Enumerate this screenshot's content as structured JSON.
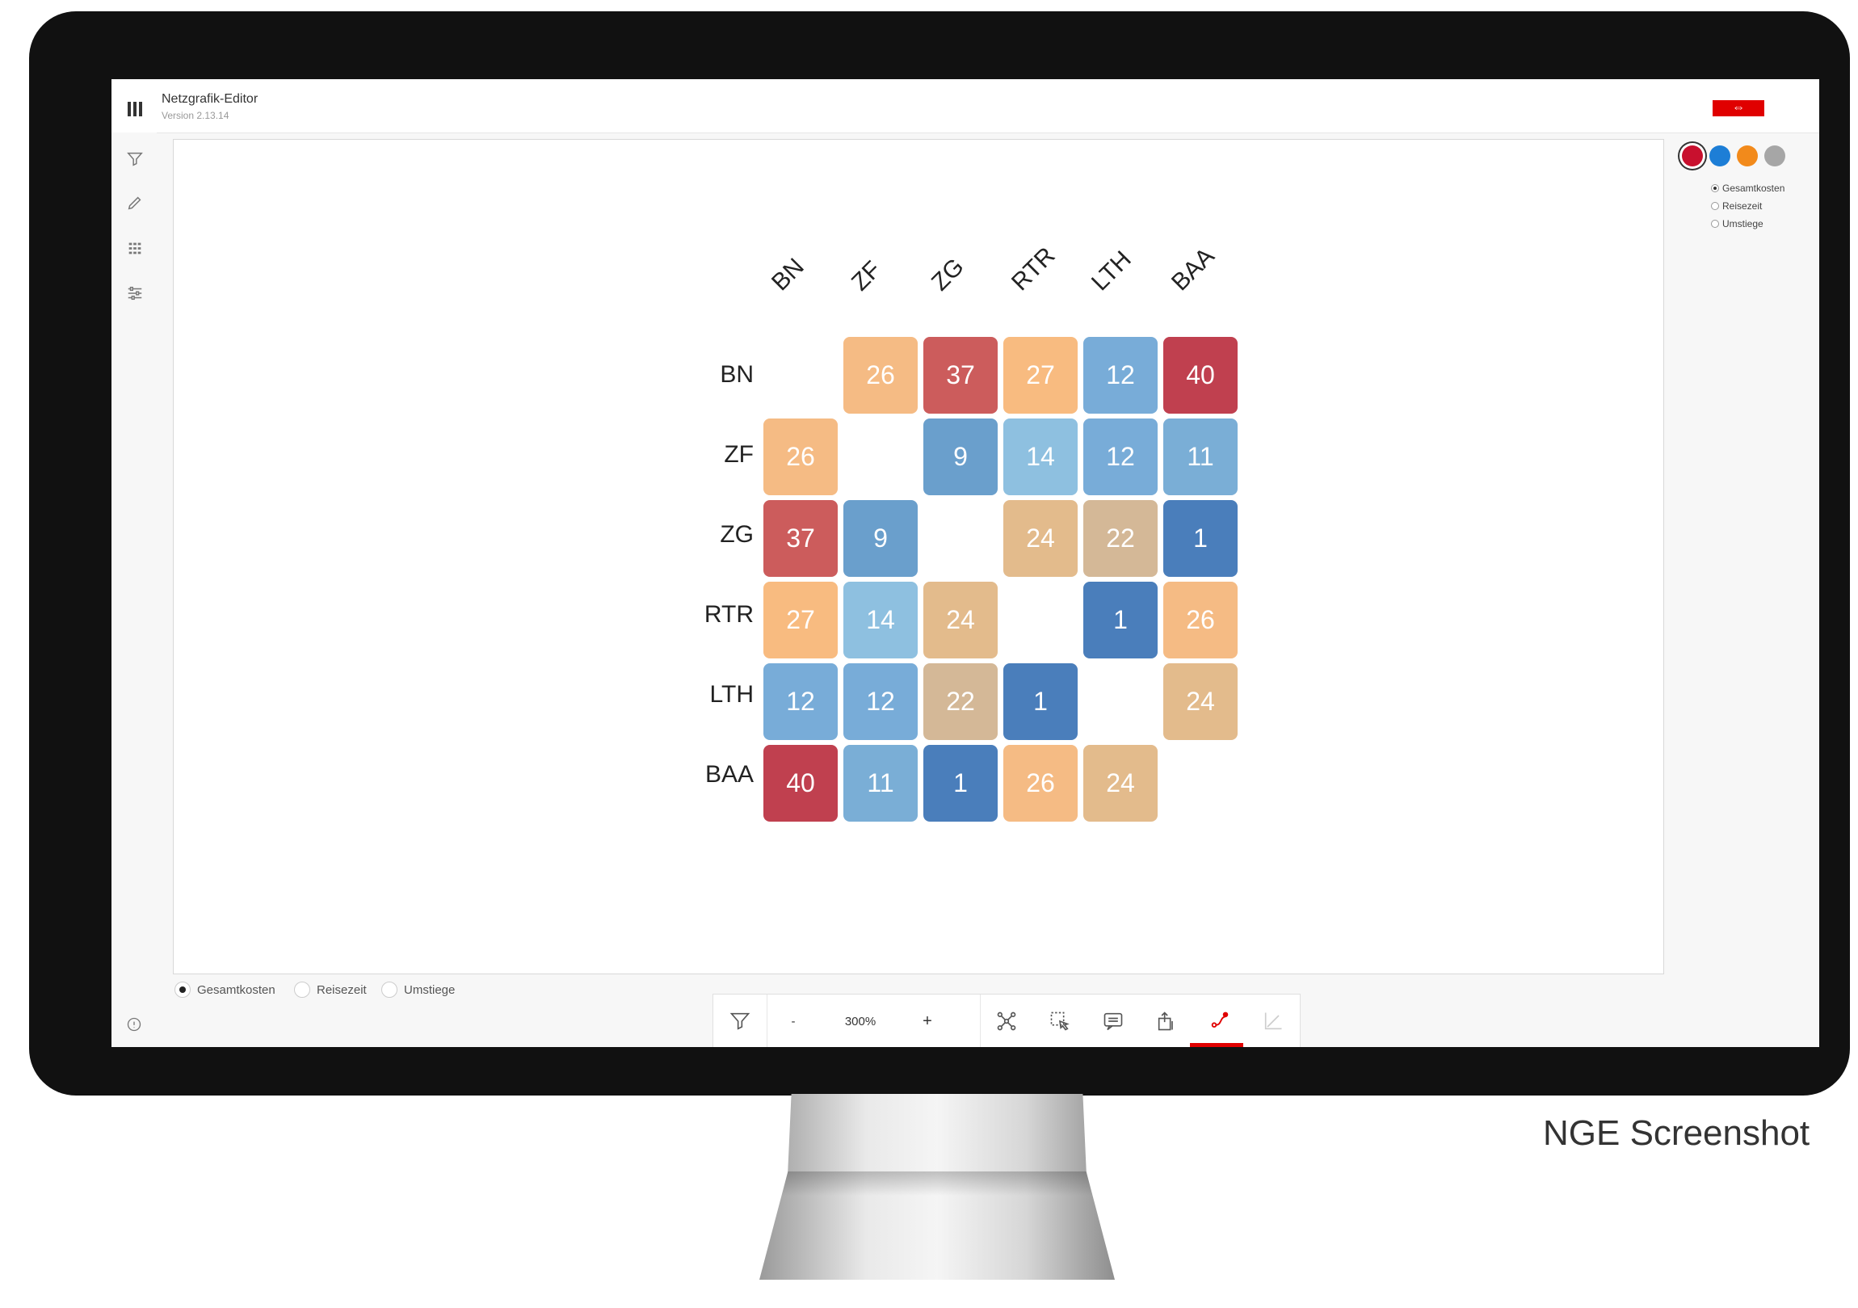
{
  "app": {
    "title": "Netzgrafik-Editor",
    "version": "Version 2.13.14",
    "brand_logo": "SBB-logo",
    "caption": "NGE Screenshot"
  },
  "sidebar": {
    "icons": [
      "filter-icon",
      "pencil-icon",
      "grid-icon",
      "sliders-icon"
    ],
    "help_icon": "help-icon"
  },
  "matrix": {
    "stations": [
      "BN",
      "ZF",
      "ZG",
      "RTR",
      "LTH",
      "BAA"
    ],
    "values": [
      [
        null,
        26,
        37,
        27,
        12,
        40
      ],
      [
        26,
        null,
        9,
        14,
        12,
        11
      ],
      [
        37,
        9,
        null,
        24,
        22,
        1
      ],
      [
        27,
        14,
        24,
        null,
        1,
        26
      ],
      [
        12,
        12,
        22,
        1,
        null,
        24
      ],
      [
        40,
        11,
        1,
        26,
        24,
        null
      ]
    ],
    "colors": {
      "1": "#4a7ebb",
      "9": "#6a9fcc",
      "11": "#7aaed6",
      "12": "#78acd8",
      "14": "#8ec0e0",
      "22": "#d4b897",
      "24": "#e3bb8c",
      "26": "#f5bb84",
      "27": "#f8bb80",
      "37": "#cc5c5c",
      "40": "#c0404f"
    }
  },
  "right_panel": {
    "swatches": [
      {
        "name": "red",
        "color": "#c8102e",
        "selected": true
      },
      {
        "name": "blue",
        "color": "#1d7ed6",
        "selected": false
      },
      {
        "name": "orange",
        "color": "#f28a1b",
        "selected": false
      },
      {
        "name": "gray",
        "color": "#a6a6a6",
        "selected": false
      }
    ],
    "options": [
      {
        "label": "Gesamtkosten",
        "selected": true
      },
      {
        "label": "Reisezeit",
        "selected": false
      },
      {
        "label": "Umstiege",
        "selected": false
      }
    ]
  },
  "bottom_options": [
    {
      "label": "Gesamtkosten",
      "selected": true
    },
    {
      "label": "Reisezeit",
      "selected": false
    },
    {
      "label": "Umstiege",
      "selected": false
    }
  ],
  "toolbar": {
    "filter_icon": "filter-icon",
    "zoom_out_label": "-",
    "zoom_level": "300%",
    "zoom_in_label": "+",
    "tools": [
      "graph-nodes-icon",
      "select-area-icon",
      "comment-icon",
      "export-icon",
      "origin-destination-icon",
      "chart-icon"
    ],
    "active_tool": "origin-destination-icon"
  }
}
